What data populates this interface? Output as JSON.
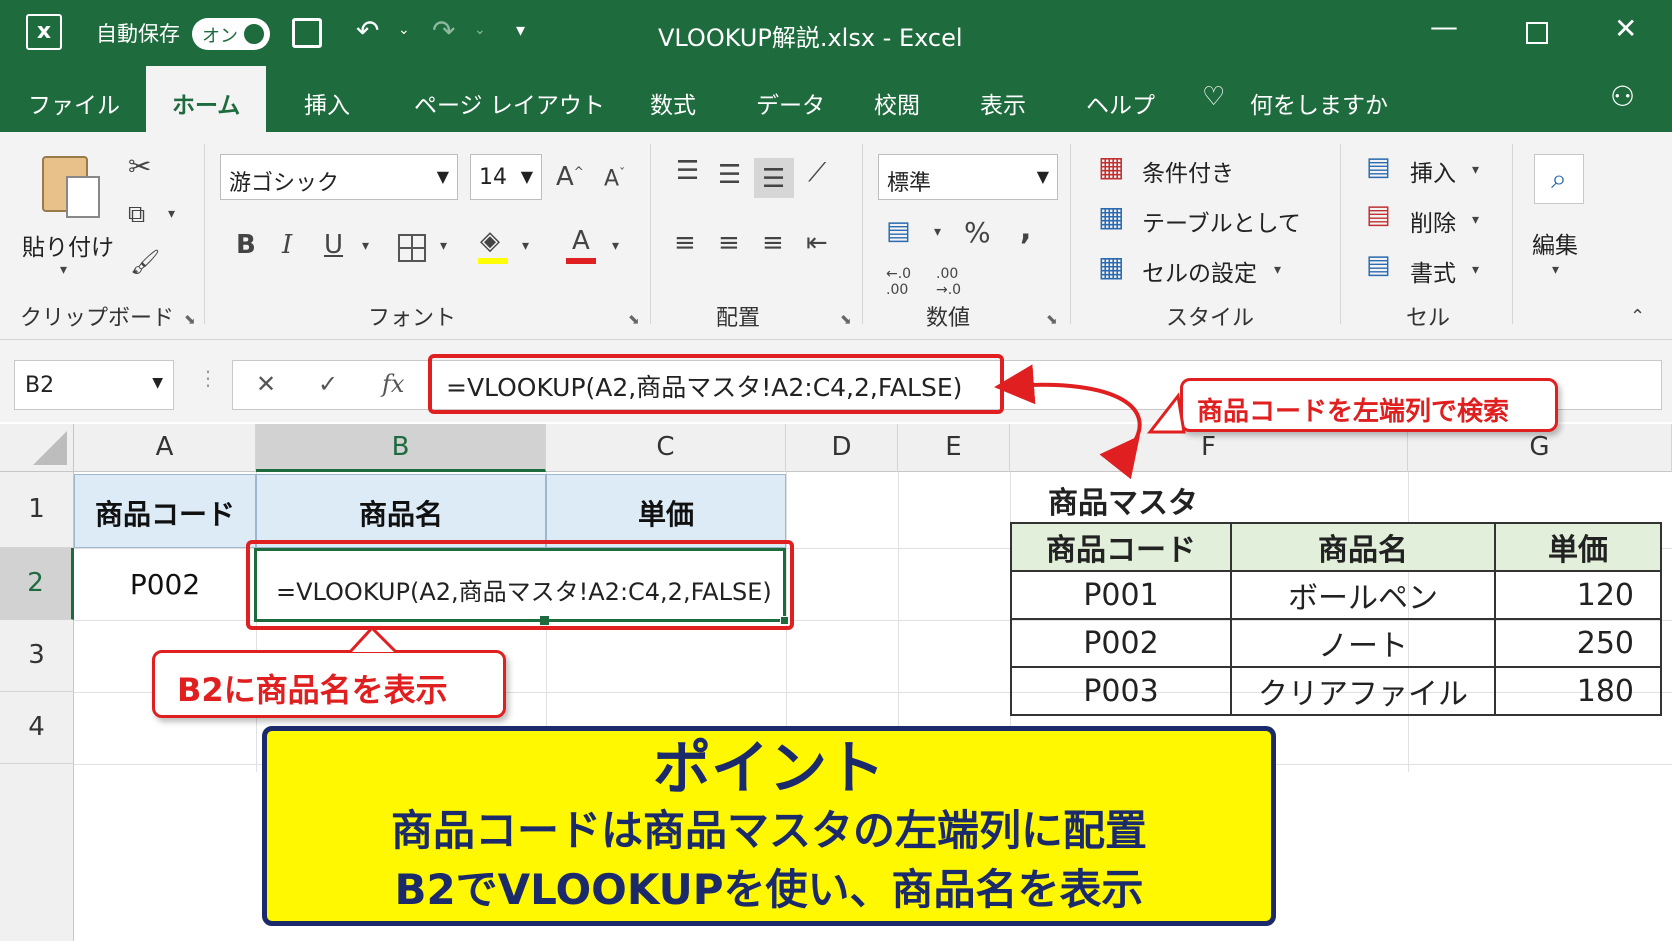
{
  "titlebar": {
    "autosave_label": "自動保存",
    "autosave_toggle": "オン",
    "title": "VLOOKUP解説.xlsx  -  Excel"
  },
  "tabs": [
    "ファイル",
    "ホーム",
    "挿入",
    "ページ レイアウト",
    "数式",
    "データ",
    "校閲",
    "表示",
    "ヘルプ"
  ],
  "tellme": "何をしますか",
  "ribbon": {
    "paste_label": "貼り付け",
    "clipboard_label": "クリップボード",
    "font_name": "游ゴシック",
    "font_size": "14",
    "font_label": "フォント",
    "alignment_label": "配置",
    "number_format": "標準",
    "number_label": "数値",
    "percent": "%",
    "comma": ",",
    "dec_inc": "←.0 .00",
    "dec_dec": ".00 →.0",
    "style_conditional": "条件付き",
    "style_table": "テーブルとして",
    "style_cell": "セルの設定",
    "style_label": "スタイル",
    "cells_insert": "挿入",
    "cells_delete": "削除",
    "cells_format": "書式",
    "cells_label": "セル",
    "edit_label": "編集",
    "bold": "B",
    "italic": "I",
    "underline": "U",
    "font_color": "A"
  },
  "formula_bar": {
    "name_box": "B2",
    "fx": "fx",
    "formula": "=VLOOKUP(A2,商品マスタ!A2:C4,2,FALSE)"
  },
  "columns": [
    "A",
    "B",
    "C",
    "D",
    "E",
    "F",
    "G"
  ],
  "rows": [
    "1",
    "2",
    "3",
    "4"
  ],
  "sheet": {
    "a1": "商品コード",
    "b1": "商品名",
    "c1": "単価",
    "a2": "P002",
    "b2": "=VLOOKUP(A2,商品マスタ!A2:C4,2,FALSE)"
  },
  "master": {
    "title": "商品マスタ",
    "headers": [
      "商品コード",
      "商品名",
      "単価"
    ],
    "rows": [
      [
        "P001",
        "ボールペン",
        "120"
      ],
      [
        "P002",
        "ノート",
        "250"
      ],
      [
        "P003",
        "クリアファイル",
        "180"
      ]
    ]
  },
  "callouts": {
    "search": "商品コードを左端列で検索",
    "display": "B2に商品名を表示"
  },
  "point": {
    "title": "ポイント",
    "line1": "商品コードは商品マスタの左端列に配置",
    "line2": "B2でVLOOKUPを使い、商品名を表示"
  },
  "colors": {
    "excel_green": "#1e6b3e",
    "callout_red": "#e02020",
    "point_yellow": "#fff800",
    "point_navy": "#1b2a6b"
  }
}
